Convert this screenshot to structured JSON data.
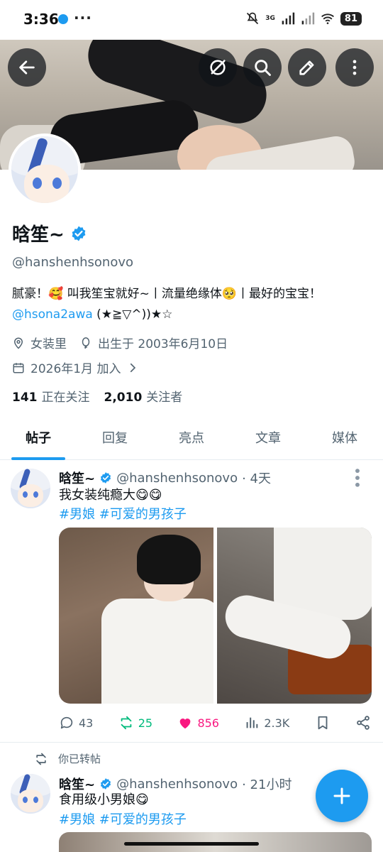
{
  "status_bar": {
    "time": "3:36",
    "more": "···",
    "network": "3G",
    "battery": "81"
  },
  "profile": {
    "name": "晗笙~",
    "handle": "@hanshenhsonovo",
    "bio_text": "腻豪！🥰 叫我笙宝就好~丨流量绝缘体🥺丨最好的宝宝！",
    "bio_link": "@hsona2awa",
    "bio_tail": " (★≧▽^))★☆",
    "location": "女装里",
    "birthday": "出生于 2003年6月10日",
    "joined": "2026年1月 加入",
    "following_count": "141",
    "following_label": "正在关注",
    "followers_count": "2,010",
    "followers_label": "关注者"
  },
  "tabs": [
    {
      "label": "帖子"
    },
    {
      "label": "回复"
    },
    {
      "label": "亮点"
    },
    {
      "label": "文章"
    },
    {
      "label": "媒体"
    }
  ],
  "tweets": [
    {
      "name": "晗笙~",
      "handle": "@hanshenhsonovo",
      "time": "· 4天",
      "text": "我女装纯瘾大😋😋",
      "tags": "#男娘 #可爱的男孩子",
      "replies": "43",
      "retweets": "25",
      "likes": "856",
      "views": "2.3K"
    },
    {
      "retweet_note": "你已转帖",
      "name": "晗笙~",
      "handle": "@hanshenhsonovo",
      "time": "· 21小时",
      "text": "食用级小男娘😋",
      "tags": "#男娘 #可爱的男孩子"
    }
  ],
  "colors": {
    "accent": "#1d9bf0",
    "retweet": "#00ba7c",
    "like": "#f91880",
    "secondary_text": "#536471"
  },
  "icons": {
    "back": "arrow-left-icon",
    "grok": "circle-slash-icon",
    "search": "search-icon",
    "edit": "pencil-icon",
    "more": "more-vertical-icon",
    "compose": "plus-icon"
  }
}
